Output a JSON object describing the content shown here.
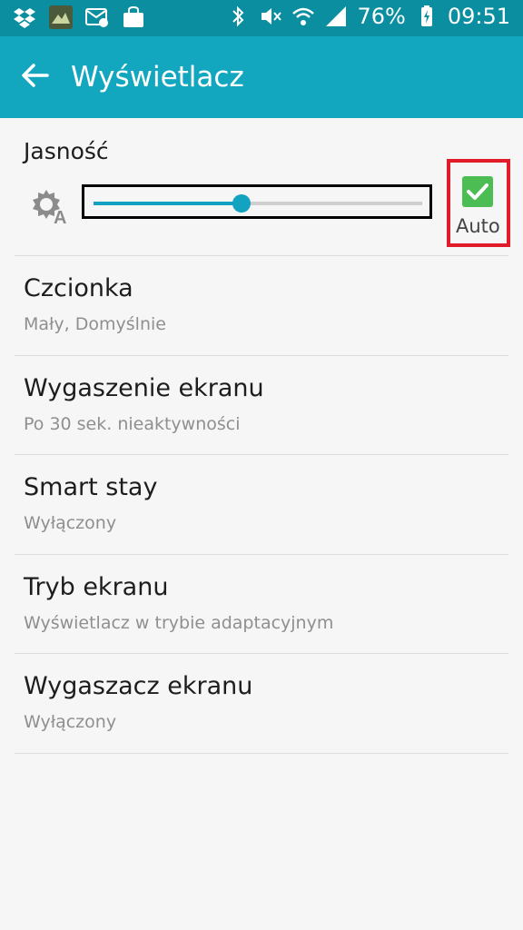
{
  "status_bar": {
    "battery": "76%",
    "time": "09:51"
  },
  "app_bar": {
    "title": "Wyświetlacz"
  },
  "brightness": {
    "label": "Jasność",
    "level": 0.45,
    "auto_checked": true,
    "auto_label": "Auto"
  },
  "items": [
    {
      "title": "Czcionka",
      "subtitle": "Mały, Domyślnie"
    },
    {
      "title": "Wygaszenie ekranu",
      "subtitle": "Po 30 sek. nieaktywności"
    },
    {
      "title": "Smart stay",
      "subtitle": "Wyłączony"
    },
    {
      "title": "Tryb ekranu",
      "subtitle": "Wyświetlacz w trybie adaptacyjnym"
    },
    {
      "title": "Wygaszacz ekranu",
      "subtitle": "Wyłączony"
    }
  ],
  "colors": {
    "status_bar": "#0a8ea0",
    "app_bar": "#12a7bf",
    "accent": "#13a2bf",
    "check": "#4bbd52",
    "highlight": "#e01b2a"
  }
}
